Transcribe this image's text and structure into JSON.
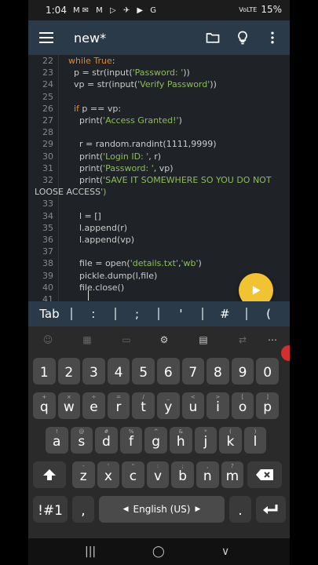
{
  "status": {
    "time": "1:04",
    "noti_icons": "M✉ M ▷ ✈ ▶ G",
    "signal": "VoLTE",
    "battery": "15%"
  },
  "appbar": {
    "title": "new*",
    "icons": [
      "menu-icon",
      "folder-icon",
      "lightbulb-icon",
      "more-icon"
    ]
  },
  "code": {
    "lines": [
      {
        "n": "22",
        "text": "  while True:"
      },
      {
        "n": "23",
        "text": "    p = str(input('Password: '))"
      },
      {
        "n": "24",
        "text": "    vp = str(input('Verify Password'))"
      },
      {
        "n": "25",
        "text": ""
      },
      {
        "n": "26",
        "text": "    if p == vp:"
      },
      {
        "n": "27",
        "text": "      print('Access Granted!')"
      },
      {
        "n": "28",
        "text": ""
      },
      {
        "n": "29",
        "text": "      r = random.randint(1111,9999)"
      },
      {
        "n": "30",
        "text": "      print('Login ID: ', r)"
      },
      {
        "n": "31",
        "text": "      print('Password: ', vp)"
      },
      {
        "n": "32",
        "text": "      print('SAVE IT SOMEWHERE SO YOU DO NOT"
      },
      {
        "n": "",
        "text": "LOOSE ACCESS')"
      },
      {
        "n": "33",
        "text": ""
      },
      {
        "n": "34",
        "text": "      l = []"
      },
      {
        "n": "35",
        "text": "      l.append(r)"
      },
      {
        "n": "36",
        "text": "      l.append(vp)"
      },
      {
        "n": "37",
        "text": ""
      },
      {
        "n": "38",
        "text": "      file = open('details.txt','wb')"
      },
      {
        "n": "39",
        "text": "      pickle.dump(l,file)"
      },
      {
        "n": "40",
        "text": "      file.close()"
      },
      {
        "n": "41",
        "text": ""
      }
    ]
  },
  "symbols": [
    "Tab",
    ":",
    ";",
    "'",
    "#",
    "("
  ],
  "keyboard": {
    "row_numbers": [
      "1",
      "2",
      "3",
      "4",
      "5",
      "6",
      "7",
      "8",
      "9",
      "0"
    ],
    "row1": [
      {
        "k": "q",
        "s": "+"
      },
      {
        "k": "w",
        "s": "×"
      },
      {
        "k": "e",
        "s": "÷"
      },
      {
        "k": "r",
        "s": "="
      },
      {
        "k": "t",
        "s": "/"
      },
      {
        "k": "y",
        "s": "_"
      },
      {
        "k": "u",
        "s": "<"
      },
      {
        "k": "i",
        "s": ">"
      },
      {
        "k": "o",
        "s": "["
      },
      {
        "k": "p",
        "s": "]"
      }
    ],
    "row2": [
      {
        "k": "a",
        "s": "!"
      },
      {
        "k": "s",
        "s": "@"
      },
      {
        "k": "d",
        "s": "#"
      },
      {
        "k": "f",
        "s": "%"
      },
      {
        "k": "g",
        "s": "^"
      },
      {
        "k": "h",
        "s": "&"
      },
      {
        "k": "j",
        "s": "*"
      },
      {
        "k": "k",
        "s": "("
      },
      {
        "k": "l",
        "s": ")"
      }
    ],
    "row3": [
      {
        "k": "z",
        "s": "-"
      },
      {
        "k": "x",
        "s": "'"
      },
      {
        "k": "c",
        "s": "\""
      },
      {
        "k": "v",
        "s": ":"
      },
      {
        "k": "b",
        "s": ";"
      },
      {
        "k": "n",
        "s": ","
      },
      {
        "k": "m",
        "s": "?"
      }
    ],
    "sym_key": "!#1",
    "comma": ",",
    "space": "English (US)",
    "period": "."
  }
}
